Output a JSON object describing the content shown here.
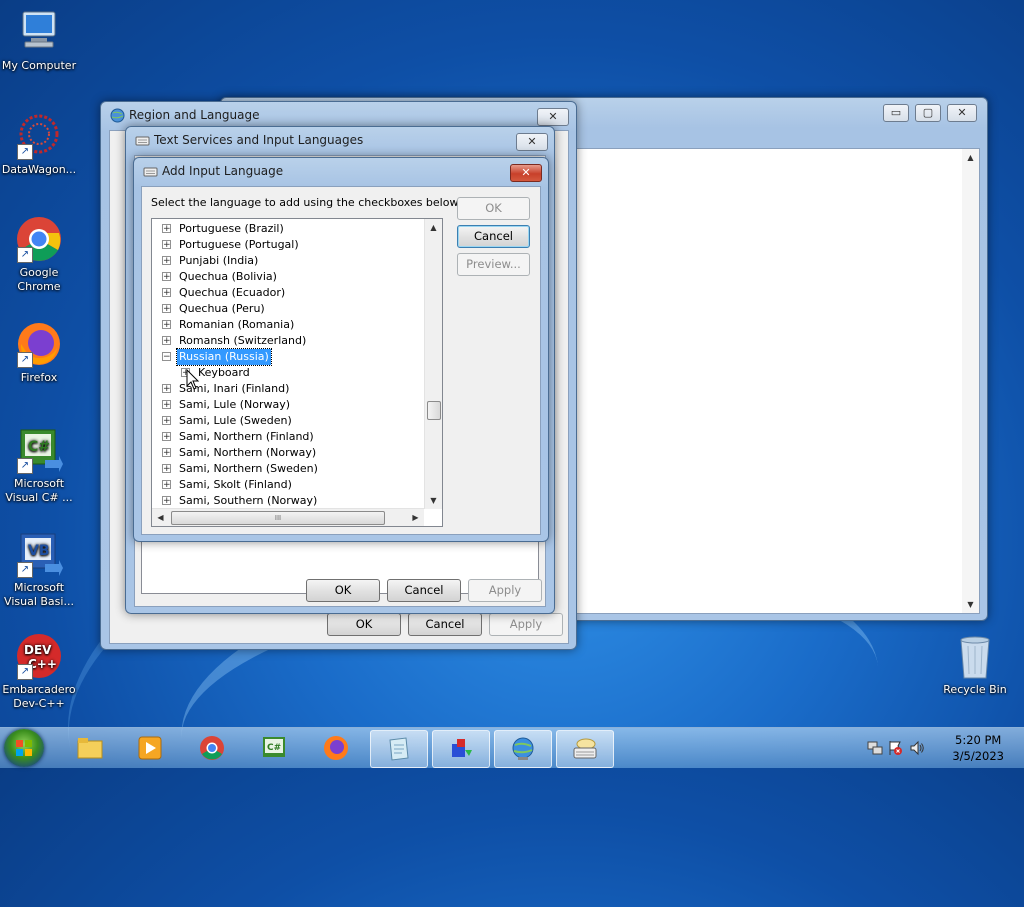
{
  "desktop_icons": [
    {
      "label": "My Computer",
      "icon": "computer-icon"
    },
    {
      "label": "DataWagon...",
      "icon": "datawagon-icon"
    },
    {
      "label": "Google Chrome",
      "icon": "chrome-icon"
    },
    {
      "label": "Firefox",
      "icon": "firefox-icon"
    },
    {
      "label": "Microsoft Visual C# ...",
      "icon": "visual-csharp-icon"
    },
    {
      "label": "Microsoft Visual Basi...",
      "icon": "visual-basic-icon"
    },
    {
      "label": "Embarcadero Dev-C++",
      "icon": "devcpp-icon"
    },
    {
      "label": "Recycle Bin",
      "icon": "recycle-bin-icon"
    }
  ],
  "region_window": {
    "title": "Region and Language",
    "close": "✕",
    "buttons": {
      "ok": "OK",
      "cancel": "Cancel",
      "apply": "Apply"
    }
  },
  "text_services_window": {
    "title": "Text Services and Input Languages",
    "close": "✕",
    "buttons": {
      "ok": "OK",
      "cancel": "Cancel",
      "apply": "Apply"
    }
  },
  "add_input_language": {
    "title": "Add Input Language",
    "close": "✕",
    "instruction": "Select the language to add using the checkboxes below.",
    "buttons": {
      "ok": "OK",
      "cancel": "Cancel",
      "preview": "Preview..."
    },
    "languages": [
      {
        "label": "Portuguese (Brazil)",
        "expander": "+"
      },
      {
        "label": "Portuguese (Portugal)",
        "expander": "+"
      },
      {
        "label": "Punjabi (India)",
        "expander": "+"
      },
      {
        "label": "Quechua (Bolivia)",
        "expander": "+"
      },
      {
        "label": "Quechua (Ecuador)",
        "expander": "+"
      },
      {
        "label": "Quechua (Peru)",
        "expander": "+"
      },
      {
        "label": "Romanian (Romania)",
        "expander": "+"
      },
      {
        "label": "Romansh (Switzerland)",
        "expander": "+"
      },
      {
        "label": "Russian (Russia)",
        "expander": "−",
        "selected": true
      },
      {
        "label": "Keyboard",
        "expander": "+",
        "child": true
      },
      {
        "label": "Sami, Inari (Finland)",
        "expander": "+"
      },
      {
        "label": "Sami, Lule (Norway)",
        "expander": "+"
      },
      {
        "label": "Sami, Lule (Sweden)",
        "expander": "+"
      },
      {
        "label": "Sami, Northern (Finland)",
        "expander": "+"
      },
      {
        "label": "Sami, Northern (Norway)",
        "expander": "+"
      },
      {
        "label": "Sami, Northern (Sweden)",
        "expander": "+"
      },
      {
        "label": "Sami, Skolt (Finland)",
        "expander": "+"
      },
      {
        "label": "Sami, Southern (Norway)",
        "expander": "+"
      }
    ],
    "hscroll_grip": "III"
  },
  "background_window": {
    "min": "▭",
    "max": "▢",
    "close": "✕"
  },
  "taskbar": {
    "items": [
      {
        "icon": "file-explorer-icon"
      },
      {
        "icon": "media-player-icon"
      },
      {
        "icon": "chrome-icon"
      },
      {
        "icon": "visual-csharp-icon"
      },
      {
        "icon": "firefox-icon"
      },
      {
        "icon": "notepad-icon",
        "active": true
      },
      {
        "icon": "app-cube-icon",
        "active": true
      },
      {
        "icon": "globe-icon",
        "active": true
      },
      {
        "icon": "keyboard-icon",
        "active": true
      }
    ],
    "time": "5:20 PM",
    "date": "3/5/2023"
  }
}
